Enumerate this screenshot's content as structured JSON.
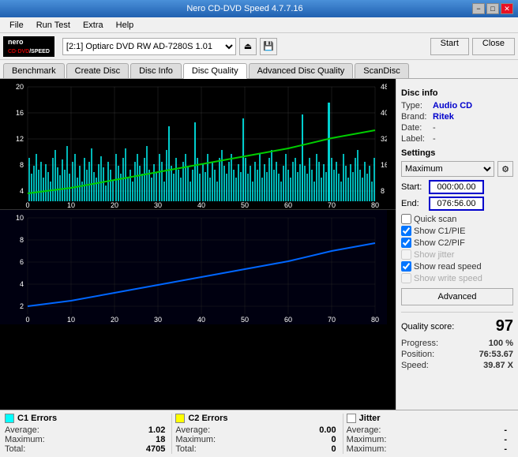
{
  "titleBar": {
    "title": "Nero CD-DVD Speed 4.7.7.16",
    "minBtn": "−",
    "maxBtn": "□",
    "closeBtn": "✕"
  },
  "menuBar": {
    "items": [
      "File",
      "Run Test",
      "Extra",
      "Help"
    ]
  },
  "toolbar": {
    "driveLabel": "[2:1]  Optiarc DVD RW AD-7280S 1.01",
    "startBtn": "Start",
    "closeBtn": "Close"
  },
  "tabs": {
    "items": [
      "Benchmark",
      "Create Disc",
      "Disc Info",
      "Disc Quality",
      "Advanced Disc Quality",
      "ScanDisc"
    ],
    "active": "Disc Quality"
  },
  "discInfo": {
    "title": "Disc info",
    "fields": [
      {
        "label": "Type:",
        "value": "Audio CD",
        "colored": true
      },
      {
        "label": "Brand:",
        "value": "Ritek",
        "colored": true
      },
      {
        "label": "Date:",
        "value": "-",
        "colored": false
      },
      {
        "label": "Label:",
        "value": "-",
        "colored": false
      }
    ]
  },
  "settings": {
    "title": "Settings",
    "speedLabel": "Maximum",
    "startLabel": "Start:",
    "startValue": "000:00.00",
    "endLabel": "End:",
    "endValue": "076:56.00",
    "checkboxes": [
      {
        "id": "quick-scan",
        "label": "Quick scan",
        "checked": false,
        "enabled": true
      },
      {
        "id": "show-c1-pie",
        "label": "Show C1/PIE",
        "checked": true,
        "enabled": true
      },
      {
        "id": "show-c2-pif",
        "label": "Show C2/PIF",
        "checked": true,
        "enabled": true
      },
      {
        "id": "show-jitter",
        "label": "Show jitter",
        "checked": false,
        "enabled": false
      },
      {
        "id": "show-read-speed",
        "label": "Show read speed",
        "checked": true,
        "enabled": true
      },
      {
        "id": "show-write-speed",
        "label": "Show write speed",
        "checked": false,
        "enabled": false
      }
    ],
    "advancedBtn": "Advanced"
  },
  "qualitySection": {
    "scoreLabel": "Quality score:",
    "scoreValue": "97",
    "progressLabel": "Progress:",
    "progressValue": "100 %",
    "positionLabel": "Position:",
    "positionValue": "76:53.67",
    "speedLabel": "Speed:",
    "speedValue": "39.87 X"
  },
  "stats": [
    {
      "title": "C1 Errors",
      "color": "#00ffff",
      "rows": [
        {
          "label": "Average:",
          "value": "1.02"
        },
        {
          "label": "Maximum:",
          "value": "18"
        },
        {
          "label": "Total:",
          "value": "4705"
        }
      ]
    },
    {
      "title": "C2 Errors",
      "color": "#ffff00",
      "rows": [
        {
          "label": "Average:",
          "value": "0.00"
        },
        {
          "label": "Maximum:",
          "value": "0"
        },
        {
          "label": "Total:",
          "value": "0"
        }
      ]
    },
    {
      "title": "Jitter",
      "color": "#ffffff",
      "rows": [
        {
          "label": "Average:",
          "value": "-"
        },
        {
          "label": "Maximum:",
          "value": "-"
        },
        {
          "label": "Maximum:",
          "value": "-"
        }
      ]
    }
  ],
  "chartTop": {
    "yAxisLabels": [
      "20",
      "16",
      "12",
      "8",
      "4"
    ],
    "yAxisRight": [
      "48",
      "40",
      "32",
      "16",
      "8"
    ],
    "xAxisLabels": [
      "0",
      "10",
      "20",
      "30",
      "40",
      "50",
      "60",
      "70",
      "80"
    ]
  },
  "chartBottom": {
    "yAxisLabels": [
      "10",
      "8",
      "6",
      "4",
      "2"
    ],
    "xAxisLabels": [
      "0",
      "10",
      "20",
      "30",
      "40",
      "50",
      "60",
      "70",
      "80"
    ]
  }
}
